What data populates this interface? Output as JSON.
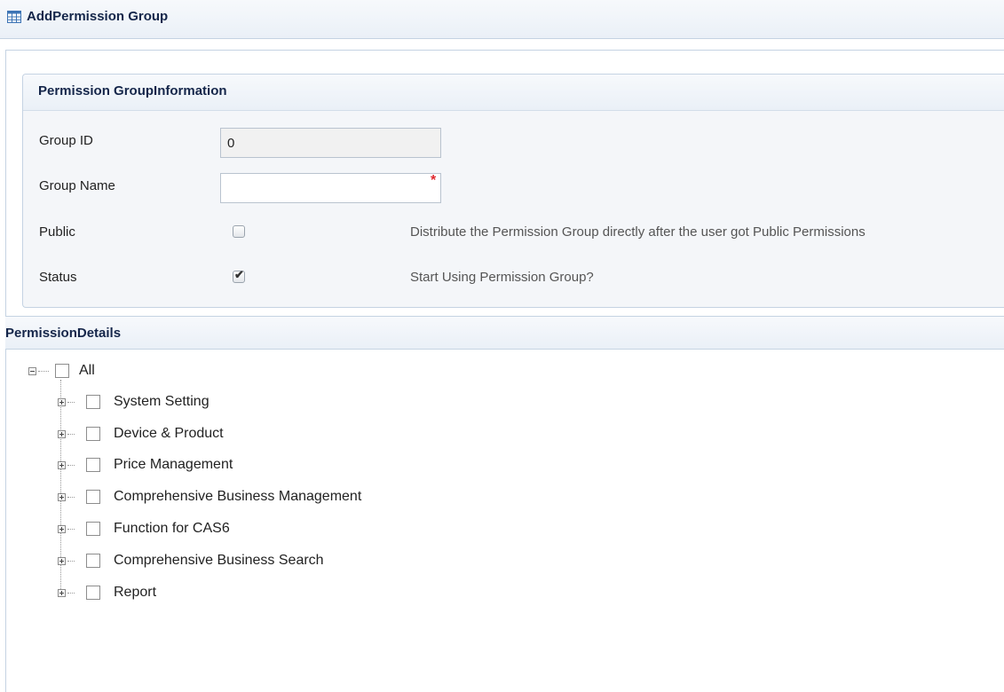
{
  "window": {
    "title": "AddPermission Group",
    "icon": "table-grid-icon"
  },
  "info_panel": {
    "title": "Permission GroupInformation",
    "group_id": {
      "label": "Group ID",
      "value": "0"
    },
    "group_name": {
      "label": "Group Name",
      "value": "",
      "required_marker": "*"
    },
    "public": {
      "label": "Public",
      "checked": false,
      "description": "Distribute the Permission Group directly after the user got Public Permissions"
    },
    "status": {
      "label": "Status",
      "checked": true,
      "description": "Start Using Permission Group?"
    }
  },
  "details": {
    "title": "PermissionDetails",
    "root": {
      "label": "All",
      "expanded": true,
      "checked": false
    },
    "items": [
      {
        "label": "System Setting",
        "expanded": false,
        "checked": false
      },
      {
        "label": "Device & Product",
        "expanded": false,
        "checked": false
      },
      {
        "label": "Price Management",
        "expanded": false,
        "checked": false
      },
      {
        "label": "Comprehensive Business Management",
        "expanded": false,
        "checked": false
      },
      {
        "label": "Function for CAS6",
        "expanded": false,
        "checked": false
      },
      {
        "label": "Comprehensive Business Search",
        "expanded": false,
        "checked": false
      },
      {
        "label": "Report",
        "expanded": false,
        "checked": false
      }
    ]
  }
}
